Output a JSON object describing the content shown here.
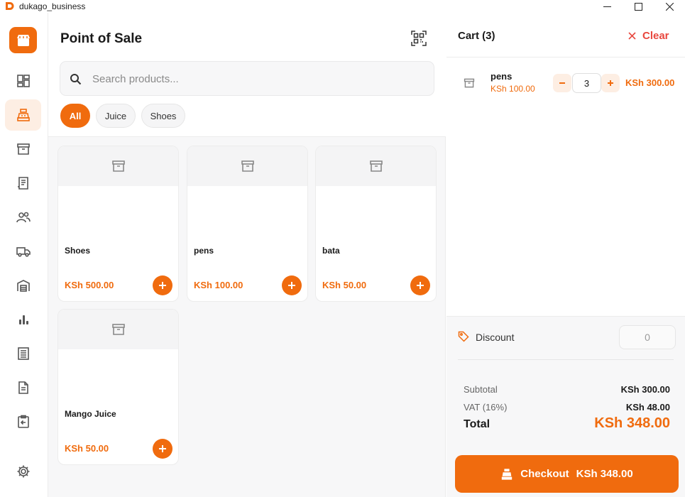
{
  "window": {
    "title": "dukago_business"
  },
  "sidebar": {
    "items": [
      {
        "icon": "dashboard-icon",
        "active": false
      },
      {
        "icon": "cash-register-icon",
        "active": true
      },
      {
        "icon": "inventory-box-icon",
        "active": false
      },
      {
        "icon": "receipt-icon",
        "active": false
      },
      {
        "icon": "customers-icon",
        "active": false
      },
      {
        "icon": "delivery-truck-icon",
        "active": false
      },
      {
        "icon": "warehouse-icon",
        "active": false
      },
      {
        "icon": "reports-chart-icon",
        "active": false
      },
      {
        "icon": "ledger-icon",
        "active": false
      },
      {
        "icon": "document-icon",
        "active": false
      },
      {
        "icon": "returns-clipboard-icon",
        "active": false
      },
      {
        "icon": "settings-gear-icon",
        "active": false
      }
    ]
  },
  "pos": {
    "title": "Point of Sale",
    "search_placeholder": "Search products...",
    "categories": [
      "All",
      "Juice",
      "Shoes"
    ],
    "active_category": "All",
    "products": [
      {
        "name": "Shoes",
        "price": "KSh 500.00"
      },
      {
        "name": "pens",
        "price": "KSh 100.00"
      },
      {
        "name": "bata",
        "price": "KSh 50.00"
      },
      {
        "name": "Mango Juice",
        "price": "KSh 50.00"
      }
    ]
  },
  "cart": {
    "title": "Cart (3)",
    "clear_label": "Clear",
    "items": [
      {
        "name": "pens",
        "unit_price": "KSh 100.00",
        "quantity": "3",
        "line_total": "KSh 300.00"
      }
    ],
    "discount_label": "Discount",
    "discount_value": "0",
    "subtotal_label": "Subtotal",
    "subtotal_value": "KSh 300.00",
    "vat_label": "VAT (16%)",
    "vat_value": "KSh 48.00",
    "total_label": "Total",
    "total_value": "KSh 348.00",
    "checkout_label": "Checkout",
    "checkout_amount": "KSh 348.00"
  },
  "colors": {
    "accent": "#f06b0e",
    "accent_light": "#fdeee3",
    "danger": "#e8473e"
  }
}
